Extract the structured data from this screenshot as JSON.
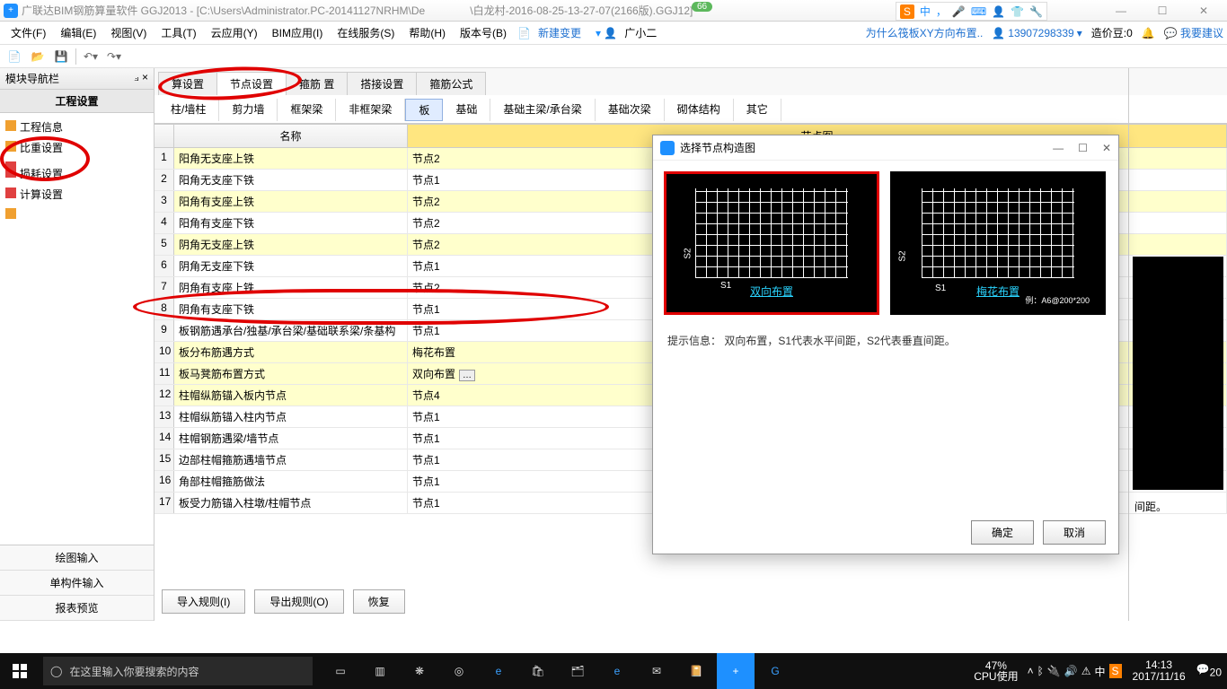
{
  "titlebar": {
    "app": "广联达BIM钢筋算量软件 GGJ2013 - [C:\\Users\\Administrator.PC-20141127NRHM\\De",
    "app2": "\\白龙村-2016-08-25-13-27-07(2166版).GGJ12]",
    "badge": "66"
  },
  "ime": {
    "s": "S",
    "items": [
      "中",
      "，",
      "🎤",
      "⌨",
      "👤",
      "👕",
      "🔧"
    ]
  },
  "menus": [
    "文件(F)",
    "编辑(E)",
    "视图(V)",
    "工具(T)",
    "云应用(Y)",
    "BIM应用(I)",
    "在线服务(S)",
    "帮助(H)",
    "版本号(B)"
  ],
  "menu_extra": {
    "new": "新建变更",
    "user": "广小二"
  },
  "menu_right": {
    "link": "为什么筏板XY方向布置..",
    "phone": "13907298339",
    "bean": "造价豆:0",
    "feedback": "我要建议"
  },
  "nav": {
    "header": "模块导航栏",
    "pin": "⟓ ×",
    "section": "工程设置",
    "items": [
      "工程信息",
      "比重设置",
      "",
      "损耗设置",
      "计算设置",
      ""
    ]
  },
  "nav_btm": [
    "绘图输入",
    "单构件输入",
    "报表预览"
  ],
  "tabs1": [
    "算设置",
    "节点设置",
    "箍筋    置",
    "搭接设置",
    "箍筋公式"
  ],
  "tabs1_active": 1,
  "tabs2": [
    "柱/墙柱",
    "剪力墙",
    "框架梁",
    "非框架梁",
    "板",
    "基础",
    "基础主梁/承台梁",
    "基础次梁",
    "砌体结构",
    "其它"
  ],
  "tabs2_active": 4,
  "grid": {
    "h1": "名称",
    "h2": "节点图",
    "rows": [
      {
        "n": 1,
        "a": "阳角无支座上铁",
        "b": "节点2",
        "y": true
      },
      {
        "n": 2,
        "a": "阳角无支座下铁",
        "b": "节点1"
      },
      {
        "n": 3,
        "a": "阳角有支座上铁",
        "b": "节点2",
        "y": true
      },
      {
        "n": 4,
        "a": "阳角有支座下铁",
        "b": "节点2"
      },
      {
        "n": 5,
        "a": "阴角无支座上铁",
        "b": "节点2",
        "y": true
      },
      {
        "n": 6,
        "a": "阴角无支座下铁",
        "b": "节点1"
      },
      {
        "n": 7,
        "a": "阴角有支座上铁",
        "b": "节点2"
      },
      {
        "n": 8,
        "a": "阴角有支座下铁",
        "b": "节点1"
      },
      {
        "n": 9,
        "a": "板钢筋遇承台/独基/承台梁/基础联系梁/条基构",
        "b": "节点1"
      },
      {
        "n": 10,
        "a": "板分布筋遇方式",
        "b": "梅花布置",
        "y": true
      },
      {
        "n": 11,
        "a": "板马凳筋布置方式",
        "b": "双向布置",
        "y": true,
        "sel": true
      },
      {
        "n": 12,
        "a": "柱帽纵筋锚入板内节点",
        "b": "节点4",
        "y": true
      },
      {
        "n": 13,
        "a": "柱帽纵筋锚入柱内节点",
        "b": "节点1"
      },
      {
        "n": 14,
        "a": "柱帽钢筋遇梁/墙节点",
        "b": "节点1"
      },
      {
        "n": 15,
        "a": "边部柱帽箍筋遇墙节点",
        "b": "节点1"
      },
      {
        "n": 16,
        "a": "角部柱帽箍筋做法",
        "b": "节点1"
      },
      {
        "n": 17,
        "a": "板受力筋锚入柱墩/柱帽节点",
        "b": "节点1"
      }
    ]
  },
  "btns": [
    "导入规则(I)",
    "导出规则(O)",
    "恢复"
  ],
  "dialog": {
    "title": "选择节点构造图",
    "opt1": "双向布置",
    "opt2": "梅花布置",
    "ex": "例：A6@200*200",
    "s1": "S1",
    "s2": "S2",
    "hint": "提示信息：  双向布置，S1代表水平间距，S2代表垂直间距。",
    "ok": "确定",
    "cancel": "取消"
  },
  "rpane": {
    "text": "间距。"
  },
  "taskbar": {
    "search_ph": "在这里输入你要搜索的内容",
    "cpu1": "47%",
    "cpu2": "CPU使用",
    "time": "14:13",
    "date": "2017/11/16",
    "ime": "中",
    "n": "20"
  }
}
